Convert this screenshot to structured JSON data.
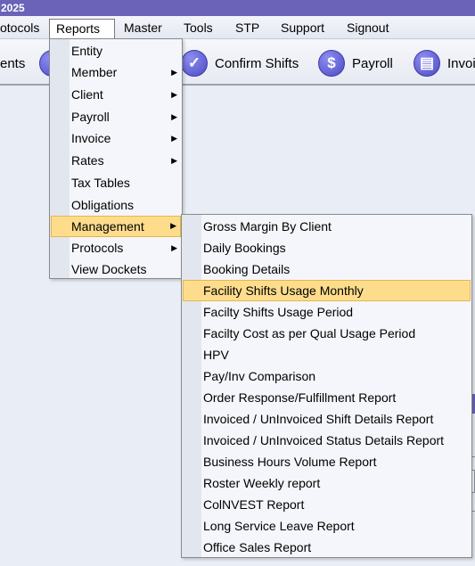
{
  "window": {
    "title_fragment": "2025"
  },
  "menubar": {
    "items": [
      {
        "label": "otocols"
      },
      {
        "label": "Reports"
      },
      {
        "label": "Master"
      },
      {
        "label": "Tools"
      },
      {
        "label": "STP"
      },
      {
        "label": "Support"
      },
      {
        "label": "Signout"
      }
    ]
  },
  "toolbar": {
    "items": [
      {
        "label": "ents",
        "icon": "document-icon"
      },
      {
        "label": "Confirm Shifts",
        "icon": "check-icon"
      },
      {
        "label": "Payroll",
        "icon": "dollar-icon"
      },
      {
        "label": "Invoi",
        "icon": "invoice-icon"
      }
    ]
  },
  "reports_menu": {
    "items": [
      {
        "label": "Entity",
        "has_submenu": false
      },
      {
        "label": "Member",
        "has_submenu": true
      },
      {
        "label": "Client",
        "has_submenu": true
      },
      {
        "label": "Payroll",
        "has_submenu": true
      },
      {
        "label": "Invoice",
        "has_submenu": true
      },
      {
        "label": "Rates",
        "has_submenu": true
      },
      {
        "label": "Tax Tables",
        "has_submenu": false
      },
      {
        "label": "Obligations",
        "has_submenu": false
      },
      {
        "label": "Management",
        "has_submenu": true,
        "highlighted": true
      },
      {
        "label": "Protocols",
        "has_submenu": true
      },
      {
        "label": "View Dockets",
        "has_submenu": false
      }
    ]
  },
  "management_menu": {
    "items": [
      {
        "label": "Gross Margin By Client"
      },
      {
        "label": "Daily Bookings"
      },
      {
        "label": "Booking Details"
      },
      {
        "label": "Facility Shifts Usage Monthly",
        "highlighted": true
      },
      {
        "label": "Facilty Shifts Usage Period"
      },
      {
        "label": "Facilty Cost as per Qual Usage Period"
      },
      {
        "label": "HPV"
      },
      {
        "label": "Pay/Inv Comparison"
      },
      {
        "label": "Order Response/Fulfillment Report"
      },
      {
        "label": "Invoiced / UnInvoiced Shift Details Report"
      },
      {
        "label": "Invoiced / UnInvoiced Status Details Report"
      },
      {
        "label": "Business Hours Volume Report"
      },
      {
        "label": "Roster Weekly report"
      },
      {
        "label": "ColNVEST Report"
      },
      {
        "label": "Long Service Leave Report"
      },
      {
        "label": "Office Sales Report"
      }
    ]
  },
  "colors": {
    "titlebar": "#6a63b8",
    "highlight": "#fddc8c",
    "highlight_border": "#e6b64d",
    "menu_bg": "#f4f6fb"
  }
}
